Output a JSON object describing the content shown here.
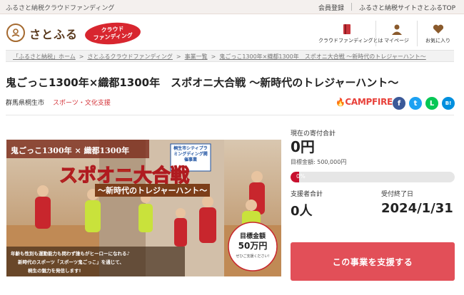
{
  "topbar": {
    "tagline": "ふるさと納税クラウドファンディング",
    "links": [
      "会員登録",
      "ふるさと納税サイトさとふるTOP"
    ]
  },
  "header": {
    "logo_text": "さとふる",
    "badge_line1": "クラウド",
    "badge_line2": "ファンディング",
    "nav": [
      {
        "label": "クラウドファンディングとは",
        "icon": "book-icon"
      },
      {
        "label": "マイページ",
        "icon": "person-icon"
      },
      {
        "label": "お気に入り",
        "icon": "heart-icon"
      }
    ]
  },
  "breadcrumb": [
    "「ふるさと納税」ホーム",
    "さとふるクラウドファンディング",
    "事業一覧",
    "鬼ごっこ1300年×織都1300年　スポオニ大合戦 ～新時代のトレジャーハント～"
  ],
  "project": {
    "title": "鬼ごっこ1300年×織都1300年　スポオニ大合戦 ～新時代のトレジャーハント～",
    "location": "群馬県桐生市",
    "category": "スポーツ・文化支援",
    "platform": "CAMPFIRE"
  },
  "share": [
    {
      "icon": "facebook-icon",
      "glyph": "f",
      "color": "#3b5998"
    },
    {
      "icon": "twitter-icon",
      "glyph": "t",
      "color": "#1da1f2"
    },
    {
      "icon": "line-icon",
      "glyph": "L",
      "color": "#06c755"
    },
    {
      "icon": "hatena-icon",
      "glyph": "B!",
      "color": "#008fde"
    }
  ],
  "hero": {
    "headline_top": "鬼ごっこ1300年 × 織都1300年",
    "headline_main": "スポオニ大合戦",
    "headline_sub": "～新時代のトレジャーハント～",
    "corner_badge": "桐生市シティプラミングディング開催事業",
    "goal_label": "目標金額",
    "goal_amount": "50万円",
    "goal_note": "ぜひご支援ください!",
    "caption_line1": "年齢も性別も運動能力も問わず誰もがヒーローになれる♪",
    "caption_line2": "新時代のスポーツ「スポーツ鬼ごっこ」を通じて、",
    "caption_line3": "桐生の魅力を発信します!"
  },
  "stats": {
    "current_label": "現在の寄付合計",
    "current_amount": "0円",
    "target_text": "目標金額: 500,000円",
    "progress_percent": 0,
    "progress_text": "0%",
    "supporters_label": "支援者合計",
    "supporters_value": "0人",
    "deadline_label": "受付終了日",
    "deadline_value": "2024/1/31"
  },
  "cta": {
    "label": "この事業を支援する"
  }
}
